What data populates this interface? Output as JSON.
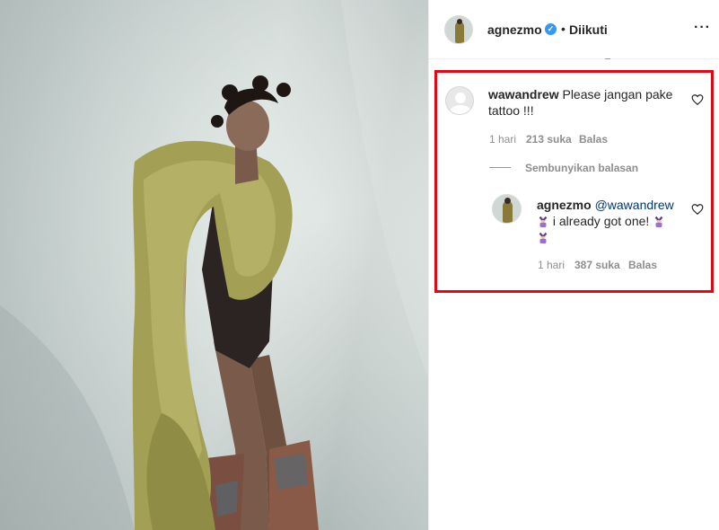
{
  "post": {
    "author": "agnezmo",
    "follow_state": "Diikuti",
    "separator": "•",
    "more_icon": "more-options-icon",
    "verified_icon": "verified-badge-icon"
  },
  "comment": {
    "user": "wawandrew",
    "text_line1": "Please jangan pake",
    "text_line2": "tattoo !!!",
    "time": "1 hari",
    "likes": "213 suka",
    "reply_label": "Balas",
    "hide_replies": "Sembunyikan balasan"
  },
  "reply": {
    "user": "agnezmo",
    "mention": "@wawandrew",
    "text": "i already got one!",
    "emoji_icon": "woman-gesturing-ok-emoji",
    "time": "1 hari",
    "likes": "387 suka",
    "reply_label": "Balas"
  },
  "colors": {
    "highlight": "#e30613",
    "verified": "#3897f0",
    "muted": "#8e8e8e"
  }
}
